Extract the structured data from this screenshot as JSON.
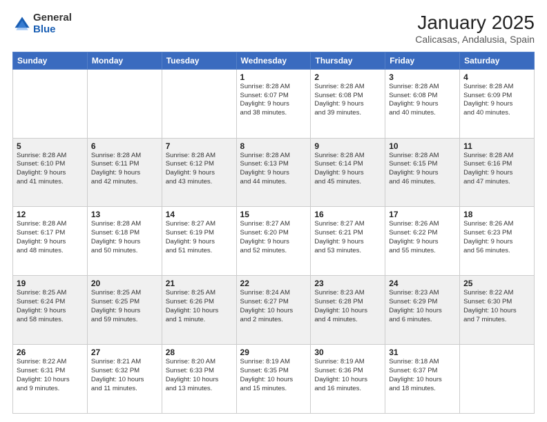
{
  "logo": {
    "general": "General",
    "blue": "Blue"
  },
  "header": {
    "month": "January 2025",
    "location": "Calicasas, Andalusia, Spain"
  },
  "weekdays": [
    "Sunday",
    "Monday",
    "Tuesday",
    "Wednesday",
    "Thursday",
    "Friday",
    "Saturday"
  ],
  "weeks": [
    [
      {
        "day": "",
        "info": ""
      },
      {
        "day": "",
        "info": ""
      },
      {
        "day": "",
        "info": ""
      },
      {
        "day": "1",
        "info": "Sunrise: 8:28 AM\nSunset: 6:07 PM\nDaylight: 9 hours\nand 38 minutes."
      },
      {
        "day": "2",
        "info": "Sunrise: 8:28 AM\nSunset: 6:08 PM\nDaylight: 9 hours\nand 39 minutes."
      },
      {
        "day": "3",
        "info": "Sunrise: 8:28 AM\nSunset: 6:08 PM\nDaylight: 9 hours\nand 40 minutes."
      },
      {
        "day": "4",
        "info": "Sunrise: 8:28 AM\nSunset: 6:09 PM\nDaylight: 9 hours\nand 40 minutes."
      }
    ],
    [
      {
        "day": "5",
        "info": "Sunrise: 8:28 AM\nSunset: 6:10 PM\nDaylight: 9 hours\nand 41 minutes."
      },
      {
        "day": "6",
        "info": "Sunrise: 8:28 AM\nSunset: 6:11 PM\nDaylight: 9 hours\nand 42 minutes."
      },
      {
        "day": "7",
        "info": "Sunrise: 8:28 AM\nSunset: 6:12 PM\nDaylight: 9 hours\nand 43 minutes."
      },
      {
        "day": "8",
        "info": "Sunrise: 8:28 AM\nSunset: 6:13 PM\nDaylight: 9 hours\nand 44 minutes."
      },
      {
        "day": "9",
        "info": "Sunrise: 8:28 AM\nSunset: 6:14 PM\nDaylight: 9 hours\nand 45 minutes."
      },
      {
        "day": "10",
        "info": "Sunrise: 8:28 AM\nSunset: 6:15 PM\nDaylight: 9 hours\nand 46 minutes."
      },
      {
        "day": "11",
        "info": "Sunrise: 8:28 AM\nSunset: 6:16 PM\nDaylight: 9 hours\nand 47 minutes."
      }
    ],
    [
      {
        "day": "12",
        "info": "Sunrise: 8:28 AM\nSunset: 6:17 PM\nDaylight: 9 hours\nand 48 minutes."
      },
      {
        "day": "13",
        "info": "Sunrise: 8:28 AM\nSunset: 6:18 PM\nDaylight: 9 hours\nand 50 minutes."
      },
      {
        "day": "14",
        "info": "Sunrise: 8:27 AM\nSunset: 6:19 PM\nDaylight: 9 hours\nand 51 minutes."
      },
      {
        "day": "15",
        "info": "Sunrise: 8:27 AM\nSunset: 6:20 PM\nDaylight: 9 hours\nand 52 minutes."
      },
      {
        "day": "16",
        "info": "Sunrise: 8:27 AM\nSunset: 6:21 PM\nDaylight: 9 hours\nand 53 minutes."
      },
      {
        "day": "17",
        "info": "Sunrise: 8:26 AM\nSunset: 6:22 PM\nDaylight: 9 hours\nand 55 minutes."
      },
      {
        "day": "18",
        "info": "Sunrise: 8:26 AM\nSunset: 6:23 PM\nDaylight: 9 hours\nand 56 minutes."
      }
    ],
    [
      {
        "day": "19",
        "info": "Sunrise: 8:25 AM\nSunset: 6:24 PM\nDaylight: 9 hours\nand 58 minutes."
      },
      {
        "day": "20",
        "info": "Sunrise: 8:25 AM\nSunset: 6:25 PM\nDaylight: 9 hours\nand 59 minutes."
      },
      {
        "day": "21",
        "info": "Sunrise: 8:25 AM\nSunset: 6:26 PM\nDaylight: 10 hours\nand 1 minute."
      },
      {
        "day": "22",
        "info": "Sunrise: 8:24 AM\nSunset: 6:27 PM\nDaylight: 10 hours\nand 2 minutes."
      },
      {
        "day": "23",
        "info": "Sunrise: 8:23 AM\nSunset: 6:28 PM\nDaylight: 10 hours\nand 4 minutes."
      },
      {
        "day": "24",
        "info": "Sunrise: 8:23 AM\nSunset: 6:29 PM\nDaylight: 10 hours\nand 6 minutes."
      },
      {
        "day": "25",
        "info": "Sunrise: 8:22 AM\nSunset: 6:30 PM\nDaylight: 10 hours\nand 7 minutes."
      }
    ],
    [
      {
        "day": "26",
        "info": "Sunrise: 8:22 AM\nSunset: 6:31 PM\nDaylight: 10 hours\nand 9 minutes."
      },
      {
        "day": "27",
        "info": "Sunrise: 8:21 AM\nSunset: 6:32 PM\nDaylight: 10 hours\nand 11 minutes."
      },
      {
        "day": "28",
        "info": "Sunrise: 8:20 AM\nSunset: 6:33 PM\nDaylight: 10 hours\nand 13 minutes."
      },
      {
        "day": "29",
        "info": "Sunrise: 8:19 AM\nSunset: 6:35 PM\nDaylight: 10 hours\nand 15 minutes."
      },
      {
        "day": "30",
        "info": "Sunrise: 8:19 AM\nSunset: 6:36 PM\nDaylight: 10 hours\nand 16 minutes."
      },
      {
        "day": "31",
        "info": "Sunrise: 8:18 AM\nSunset: 6:37 PM\nDaylight: 10 hours\nand 18 minutes."
      },
      {
        "day": "",
        "info": ""
      }
    ]
  ]
}
